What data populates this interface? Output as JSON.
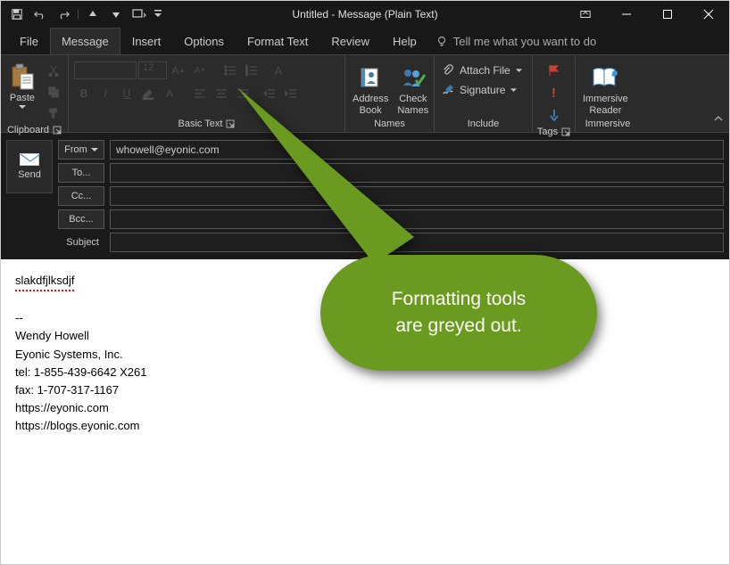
{
  "title": "Untitled  -  Message (Plain Text)",
  "tabs": {
    "file": "File",
    "message": "Message",
    "insert": "Insert",
    "options": "Options",
    "format_text": "Format Text",
    "review": "Review",
    "help": "Help",
    "tell_me": "Tell me what you want to do"
  },
  "ribbon": {
    "clipboard": {
      "paste": "Paste",
      "label": "Clipboard"
    },
    "basic_text": {
      "font_size": "12",
      "label": "Basic Text"
    },
    "names": {
      "address_book": "Address\nBook",
      "check_names": "Check\nNames",
      "label": "Names"
    },
    "include": {
      "attach_file": "Attach File",
      "signature": "Signature",
      "label": "Include"
    },
    "tags": {
      "label": "Tags"
    },
    "immersive": {
      "reader": "Immersive\nReader",
      "label": "Immersive"
    }
  },
  "header": {
    "send": "Send",
    "from_label": "From",
    "from_value": "whowell@eyonic.com",
    "to_label": "To...",
    "cc_label": "Cc...",
    "bcc_label": "Bcc...",
    "subject_label": "Subject"
  },
  "body": {
    "line1": "slakdfjlksdjf",
    "sig_sep": "--",
    "sig_name": "Wendy Howell",
    "sig_company": "Eyonic Systems, Inc.",
    "sig_tel": "tel: 1-855-439-6642 X261",
    "sig_fax": "fax: 1-707-317-1167",
    "sig_url1": "https://eyonic.com",
    "sig_url2": "https://blogs.eyonic.com"
  },
  "callout": {
    "line1": "Formatting tools",
    "line2": "are greyed out."
  }
}
